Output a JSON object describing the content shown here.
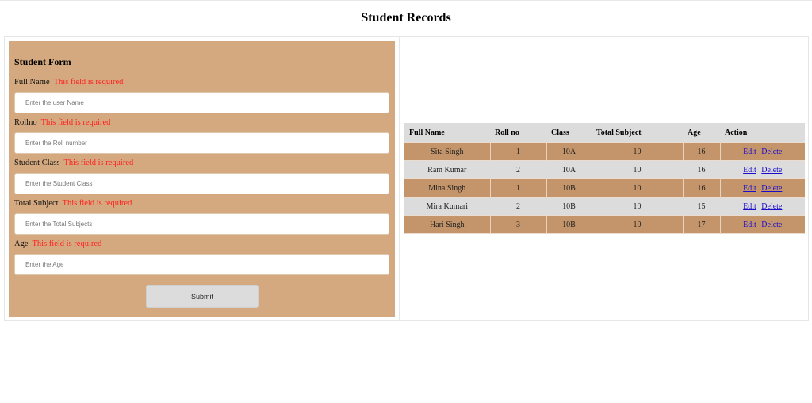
{
  "page": {
    "title": "Student Records"
  },
  "form": {
    "title": "Student Form",
    "error_text": "This field is required",
    "fields": [
      {
        "label": "Full Name",
        "error": "This field is required",
        "placeholder": "Enter the user Name",
        "value": ""
      },
      {
        "label": "Rollno",
        "error": "This field is required",
        "placeholder": "Enter the Roll number",
        "value": ""
      },
      {
        "label": "Student Class",
        "error": "This field is required",
        "placeholder": "Enter the Student Class",
        "value": ""
      },
      {
        "label": "Total Subject",
        "error": "This field is required",
        "placeholder": "Enter the Total Subjects",
        "value": ""
      },
      {
        "label": "Age",
        "error": "This field is required",
        "placeholder": "Enter the Age",
        "value": ""
      }
    ],
    "submit_label": "Submit"
  },
  "table": {
    "columns": [
      "Full Name",
      "Roll no",
      "Class",
      "Total Subject",
      "Age",
      "Action"
    ],
    "rows": [
      {
        "name": "Sita Singh",
        "roll": "1",
        "class": "10A",
        "total_subject": "10",
        "age": "16",
        "edit": "Edit",
        "delete": "Delete"
      },
      {
        "name": "Ram Kumar",
        "roll": "2",
        "class": "10A",
        "total_subject": "10",
        "age": "16",
        "edit": "Edit",
        "delete": "Delete"
      },
      {
        "name": "Mina Singh",
        "roll": "1",
        "class": "10B",
        "total_subject": "10",
        "age": "16",
        "edit": "Edit",
        "delete": "Delete"
      },
      {
        "name": "Mira Kumari",
        "roll": "2",
        "class": "10B",
        "total_subject": "10",
        "age": "15",
        "edit": "Edit",
        "delete": "Delete"
      },
      {
        "name": "Hari Singh",
        "roll": "3",
        "class": "10B",
        "total_subject": "10",
        "age": "17",
        "edit": "Edit",
        "delete": "Delete"
      }
    ]
  },
  "colors": {
    "form_bg": "#d4a97f",
    "row_odd": "#c4956a",
    "row_even": "#dcdcdc",
    "error": "#ff2020",
    "link": "#1a0dcc"
  }
}
